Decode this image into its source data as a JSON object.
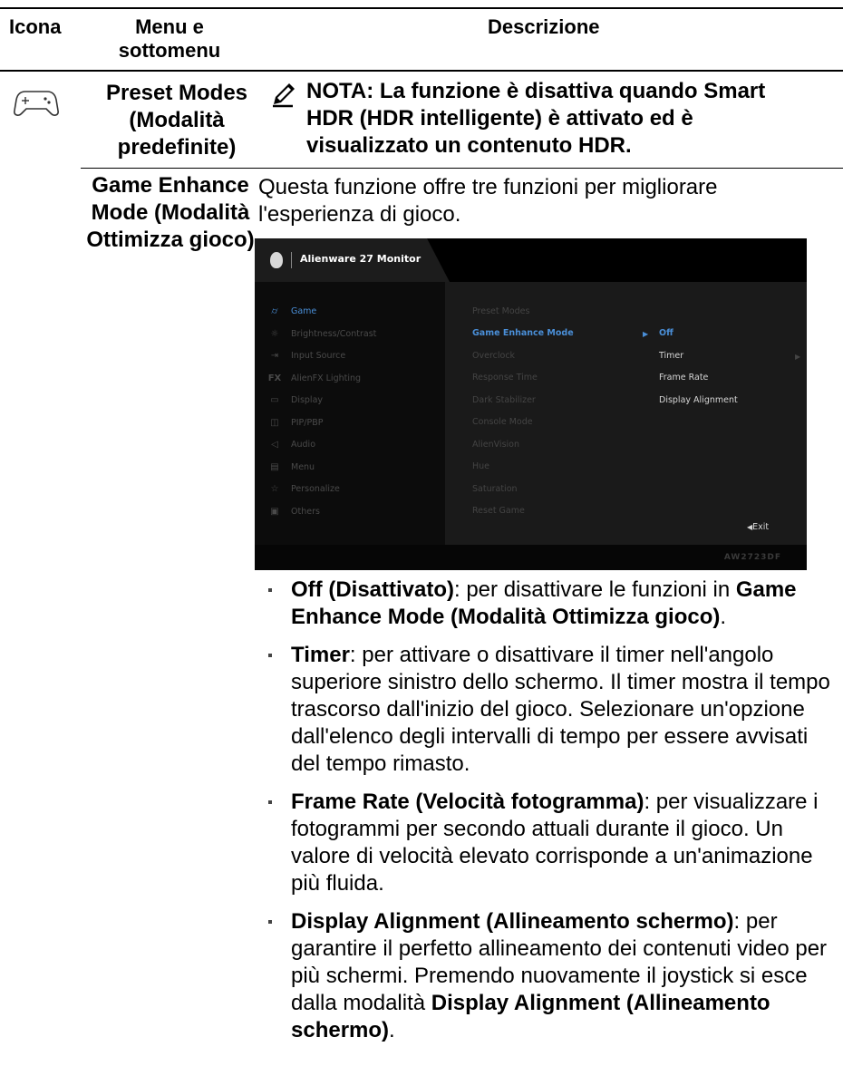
{
  "table": {
    "headers": {
      "icon": "Icona",
      "menu": "Menu e sottomenu",
      "description": "Descrizione"
    },
    "row1": {
      "icon_name": "gamepad-icon",
      "menu": "Preset Modes (Modalità predefinite)",
      "note": "NOTA: La funzione è disattiva quando Smart HDR (HDR intelligente) è attivato ed è visualizzato un contenuto HDR."
    },
    "row2": {
      "menu": "Game Enhance Mode (Modalità Ottimizza gioco)",
      "intro": "Questa funzione offre tre funzioni per migliorare l'esperienza di gioco.",
      "bullets": [
        {
          "bold": "Off (Disattivato)",
          "text": ": per disattivare le funzioni in ",
          "bold2": "Game Enhance Mode (Modalità Ottimizza gioco)",
          "tail": "."
        },
        {
          "bold": "Timer",
          "text": ": per attivare o disattivare il timer nell'angolo superiore sinistro dello schermo. Il timer mostra il tempo trascorso dall'inizio del gioco. Selezionare un'opzione dall'elenco degli intervalli di tempo per essere avvisati del tempo rimasto.",
          "bold2": "",
          "tail": ""
        },
        {
          "bold": "Frame Rate (Velocità fotogramma)",
          "text": ": per visualizzare i fotogrammi per secondo attuali durante il gioco. Un valore di velocità elevato corrisponde a un'animazione più fluida.",
          "bold2": "",
          "tail": ""
        },
        {
          "bold": "Display Alignment (Allineamento schermo)",
          "text": ": per garantire il perfetto allineamento dei contenuti video per più schermi. Premendo nuovamente il joystick si esce dalla modalità ",
          "bold2": "Display Alignment (Allineamento schermo)",
          "tail": "."
        }
      ]
    }
  },
  "osd": {
    "title": "Alienware 27 Monitor",
    "model": "AW2723DF",
    "accent_color": "#4a8fd8",
    "nav": [
      {
        "label": "Game",
        "icon": "gamepad-icon"
      },
      {
        "label": "Brightness/Contrast",
        "icon": "brightness-icon"
      },
      {
        "label": "Input Source",
        "icon": "input-source-icon"
      },
      {
        "label": "AlienFX Lighting",
        "icon": "fx-icon"
      },
      {
        "label": "Display",
        "icon": "display-icon"
      },
      {
        "label": "PIP/PBP",
        "icon": "pip-icon"
      },
      {
        "label": "Audio",
        "icon": "speaker-icon"
      },
      {
        "label": "Menu",
        "icon": "menu-icon"
      },
      {
        "label": "Personalize",
        "icon": "star-icon"
      },
      {
        "label": "Others",
        "icon": "others-icon"
      }
    ],
    "submenu": [
      "Preset Modes",
      "Game Enhance Mode",
      "Overclock",
      "Response Time",
      "Dark Stabilizer",
      "Console Mode",
      "AlienVision",
      "Hue",
      "Saturation",
      "Reset Game"
    ],
    "options": [
      "Off",
      "Timer",
      "Frame Rate",
      "Display Alignment"
    ],
    "exit": "Exit"
  }
}
